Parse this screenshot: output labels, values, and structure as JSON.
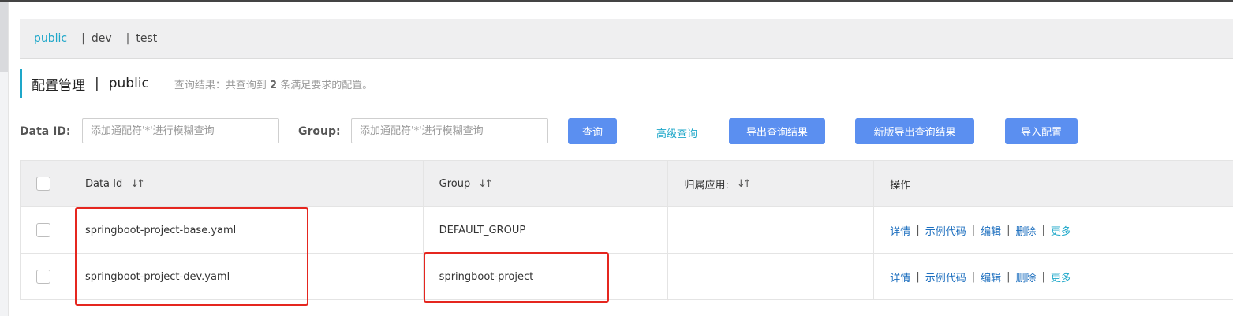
{
  "namespaces": {
    "items": [
      {
        "label": "public",
        "active": true
      },
      {
        "label": "dev",
        "active": false
      },
      {
        "label": "test",
        "active": false
      }
    ],
    "separator": "|"
  },
  "header": {
    "title": "配置管理",
    "separator": "|",
    "namespace": "public",
    "result_prefix": "查询结果：共查询到 ",
    "result_count": "2",
    "result_suffix": " 条满足要求的配置。"
  },
  "search": {
    "data_id_label": "Data ID:",
    "data_id_placeholder": "添加通配符'*'进行模糊查询",
    "group_label": "Group:",
    "group_placeholder": "添加通配符'*'进行模糊查询",
    "query_button": "查询",
    "advanced_link": "高级查询",
    "export_button": "导出查询结果",
    "new_export_button": "新版导出查询结果",
    "import_button": "导入配置"
  },
  "table": {
    "columns": {
      "data_id": "Data Id",
      "group": "Group",
      "app": "归属应用:",
      "actions": "操作"
    },
    "sort_glyph": "↓↑",
    "rows": [
      {
        "data_id": "springboot-project-base.yaml",
        "group": "DEFAULT_GROUP",
        "app": ""
      },
      {
        "data_id": "springboot-project-dev.yaml",
        "group": "springboot-project",
        "app": ""
      }
    ],
    "actions": {
      "detail": "详情",
      "sample_code": "示例代码",
      "edit": "编辑",
      "delete": "删除",
      "more": "更多",
      "separator": "|"
    }
  },
  "colors": {
    "accent": "#1ea7c9",
    "button": "#5b8ff0",
    "link": "#1d6fbf",
    "annotation": "#e5261f"
  }
}
